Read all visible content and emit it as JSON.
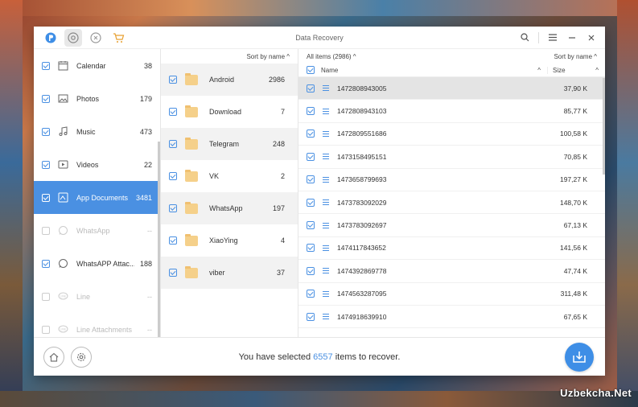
{
  "window": {
    "title": "Data Recovery"
  },
  "toolbar": {
    "icons": [
      "phone-recovery-icon",
      "settings-circle-icon",
      "restore-icon",
      "cart-icon"
    ],
    "controls": [
      "search-icon",
      "menu-icon",
      "minimize-icon",
      "close-icon"
    ]
  },
  "sidebar": {
    "items": [
      {
        "label": "Calendar",
        "count": "38",
        "icon": "calendar-icon",
        "checked": true,
        "state": "normal"
      },
      {
        "label": "Photos",
        "count": "179",
        "icon": "image-icon",
        "checked": true,
        "state": "normal"
      },
      {
        "label": "Music",
        "count": "473",
        "icon": "music-icon",
        "checked": true,
        "state": "normal"
      },
      {
        "label": "Videos",
        "count": "22",
        "icon": "video-icon",
        "checked": true,
        "state": "normal"
      },
      {
        "label": "App Documents",
        "count": "3481",
        "icon": "app-docs-icon",
        "checked": true,
        "state": "selected"
      },
      {
        "label": "WhatsApp",
        "count": "--",
        "icon": "whatsapp-icon",
        "checked": false,
        "state": "disabled"
      },
      {
        "label": "WhatsAPP Attac...",
        "count": "188",
        "icon": "whatsapp-icon",
        "checked": true,
        "state": "normal"
      },
      {
        "label": "Line",
        "count": "--",
        "icon": "line-icon",
        "checked": false,
        "state": "disabled"
      },
      {
        "label": "Line Attachments",
        "count": "--",
        "icon": "line-icon",
        "checked": false,
        "state": "disabled"
      }
    ]
  },
  "folders": {
    "sort_label": "Sort by name ^",
    "items": [
      {
        "name": "Android",
        "count": "2986"
      },
      {
        "name": "Download",
        "count": "7"
      },
      {
        "name": "Telegram",
        "count": "248"
      },
      {
        "name": "VK",
        "count": "2"
      },
      {
        "name": "WhatsApp",
        "count": "197"
      },
      {
        "name": "XiaoYing",
        "count": "4"
      },
      {
        "name": "viber",
        "count": "37"
      }
    ]
  },
  "files": {
    "all_items_label": "All items (2986) ^",
    "sort_label": "Sort by name ^",
    "col_name": "Name",
    "col_size": "Size",
    "rows": [
      {
        "name": "1472808943005",
        "size": "37,90 K"
      },
      {
        "name": "1472808943103",
        "size": "85,77 K"
      },
      {
        "name": "1472809551686",
        "size": "100,58 K"
      },
      {
        "name": "1473158495151",
        "size": "70,85 K"
      },
      {
        "name": "1473658799693",
        "size": "197,27 K"
      },
      {
        "name": "1473783092029",
        "size": "148,70 K"
      },
      {
        "name": "1473783092697",
        "size": "67,13 K"
      },
      {
        "name": "1474117843652",
        "size": "141,56 K"
      },
      {
        "name": "1474392869778",
        "size": "47,74 K"
      },
      {
        "name": "1474563287095",
        "size": "311,48 K"
      },
      {
        "name": "1474918639910",
        "size": "67,65 K"
      }
    ]
  },
  "footer": {
    "msg_prefix": "You have selected ",
    "selected_count": "6557",
    "msg_suffix": " items to recover."
  },
  "watermark": "Uzbekcha.Net",
  "colors": {
    "accent": "#4a90e2"
  }
}
